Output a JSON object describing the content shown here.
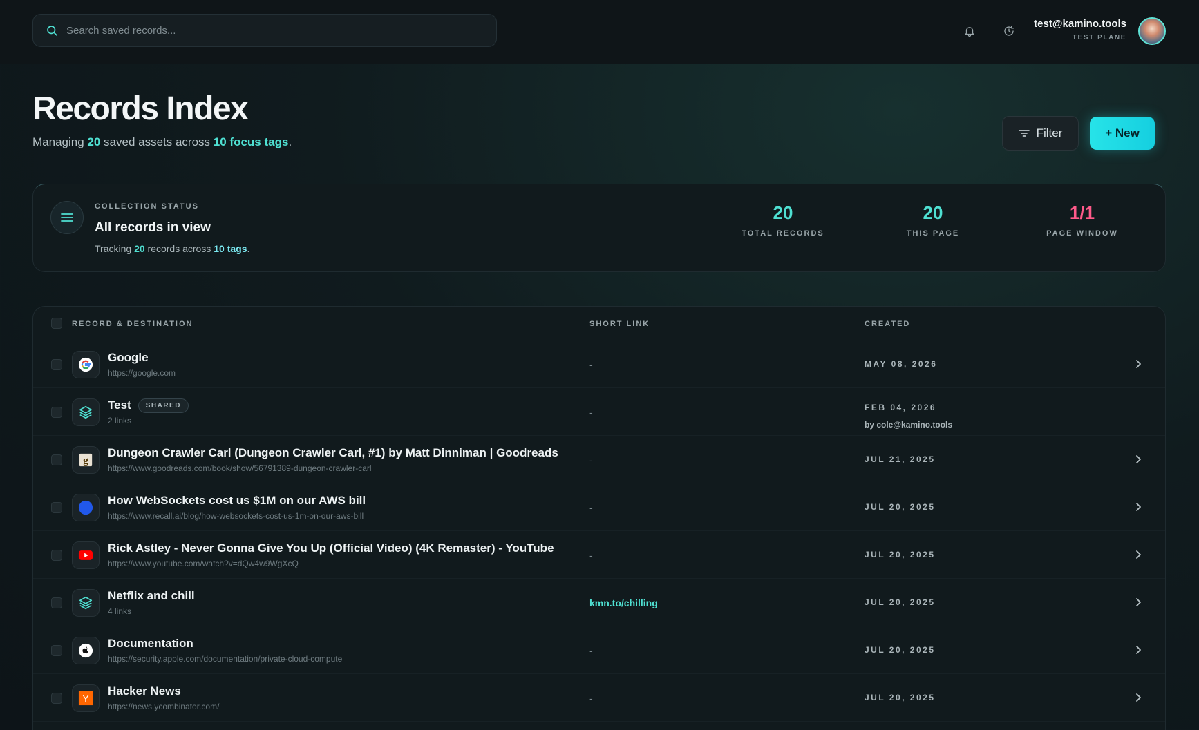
{
  "topbar": {
    "search_placeholder": "Search saved records...",
    "user_email": "test@kamino.tools",
    "user_plan": "TEST PLANE"
  },
  "header": {
    "title": "Records Index",
    "sub_prefix": "Managing ",
    "sub_count": "20",
    "sub_mid": " saved assets across ",
    "sub_tags": "10 focus tags",
    "sub_suffix": ".",
    "filter_label": "Filter",
    "new_label": "+ New"
  },
  "status": {
    "label": "COLLECTION STATUS",
    "title": "All records in view",
    "desc_prefix": "Tracking ",
    "desc_count": "20",
    "desc_mid": " records across ",
    "desc_tags": "10 tags",
    "desc_suffix": ".",
    "stats": [
      {
        "value": "20",
        "label": "TOTAL RECORDS"
      },
      {
        "value": "20",
        "label": "THIS PAGE"
      },
      {
        "value": "1/1",
        "label": "PAGE WINDOW"
      }
    ]
  },
  "table": {
    "columns": [
      "RECORD & DESTINATION",
      "SHORT LINK",
      "CREATED"
    ],
    "rows": [
      {
        "title": "Google",
        "url": "https://google.com",
        "short": "-",
        "date": "MAY 08, 2026",
        "icon": "google-icon"
      },
      {
        "title": "Test",
        "badge": "SHARED",
        "url": "2 links",
        "short": "-",
        "date": "FEB 04, 2026",
        "by": "by cole@kamino.tools",
        "icon": "layers-icon"
      },
      {
        "title": "Dungeon Crawler Carl (Dungeon Crawler Carl, #1) by Matt Dinniman | Goodreads",
        "url": "https://www.goodreads.com/book/show/56791389-dungeon-crawler-carl",
        "short": "-",
        "date": "JUL 21, 2025",
        "icon": "goodreads-icon"
      },
      {
        "title": "How WebSockets cost us $1M on our AWS bill",
        "url": "https://www.recall.ai/blog/how-websockets-cost-us-1m-on-our-aws-bill",
        "short": "-",
        "date": "JUL 20, 2025",
        "icon": "blue-dot-icon"
      },
      {
        "title": "Rick Astley - Never Gonna Give You Up (Official Video) (4K Remaster) - YouTube",
        "url": "https://www.youtube.com/watch?v=dQw4w9WgXcQ",
        "short": "-",
        "date": "JUL 20, 2025",
        "icon": "youtube-icon"
      },
      {
        "title": "Netflix and chill",
        "url": "4 links",
        "short": "kmn.to/chilling",
        "date": "JUL 20, 2025",
        "icon": "layers-icon"
      },
      {
        "title": "Documentation",
        "url": "https://security.apple.com/documentation/private-cloud-compute",
        "short": "-",
        "date": "JUL 20, 2025",
        "icon": "apple-icon"
      },
      {
        "title": "Hacker News",
        "url": "https://news.ycombinator.com/",
        "short": "-",
        "date": "JUL 20, 2025",
        "icon": "hackernews-icon"
      }
    ]
  },
  "colors": {
    "accent": "#4fe0d2",
    "pink": "#ff5a8a",
    "new_button": "#27e3e8"
  }
}
